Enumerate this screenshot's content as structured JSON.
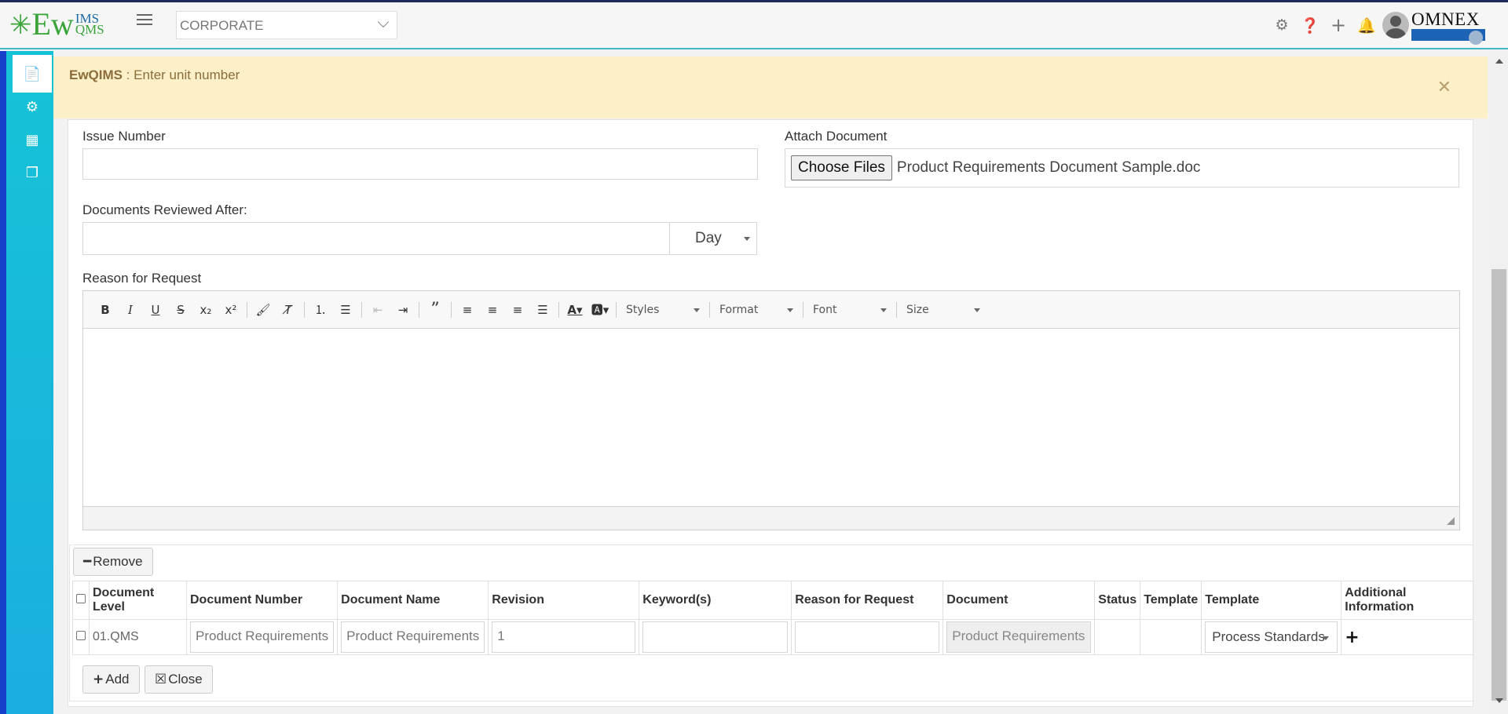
{
  "header": {
    "logo_ew": "Ew",
    "logo_ims": "IMS",
    "logo_qms": "QMS",
    "org_select_value": "CORPORATE",
    "brand": "OMNEX",
    "icons": [
      "gear-icon",
      "help-icon",
      "plus-icon",
      "bell-icon",
      "avatar"
    ]
  },
  "sidebar": {
    "items": [
      {
        "icon": "document-icon",
        "active": true
      },
      {
        "icon": "cogs-icon",
        "active": false
      },
      {
        "icon": "building-icon",
        "active": false
      },
      {
        "icon": "copy-icon",
        "active": false
      }
    ]
  },
  "alert": {
    "app": "EwQIMS",
    "message": " : Enter unit number"
  },
  "form": {
    "issue_number_label": "Issue Number",
    "issue_number_value": "",
    "attach_label": "Attach Document",
    "choose_files_label": "Choose Files",
    "attached_file": "Product Requirements Document Sample.doc",
    "reviewed_after_label": "Documents Reviewed After:",
    "reviewed_after_value": "",
    "reviewed_unit": "Day",
    "reason_label": "Reason for Request"
  },
  "editor": {
    "styles_label": "Styles",
    "format_label": "Format",
    "font_label": "Font",
    "size_label": "Size"
  },
  "table": {
    "remove_label": "Remove",
    "add_label": "Add",
    "close_label": "Close",
    "headers": {
      "level_1": "Document",
      "level_2": "Level",
      "number": "Document Number",
      "name": "Document Name",
      "revision": "Revision",
      "keywords": "Keyword(s)",
      "reason": "Reason for Request",
      "document": "Document",
      "status": "Status",
      "template1": "Template",
      "template2": "Template",
      "additional_1": "Additional",
      "additional_2": "Information"
    },
    "rows": [
      {
        "level": "01.QMS",
        "number": "Product Requirements",
        "name": "Product Requirements",
        "revision": "1",
        "keywords": "",
        "reason": "",
        "document": "Product Requirements",
        "status": "",
        "template1": "",
        "template2": "Process Standards"
      }
    ]
  }
}
